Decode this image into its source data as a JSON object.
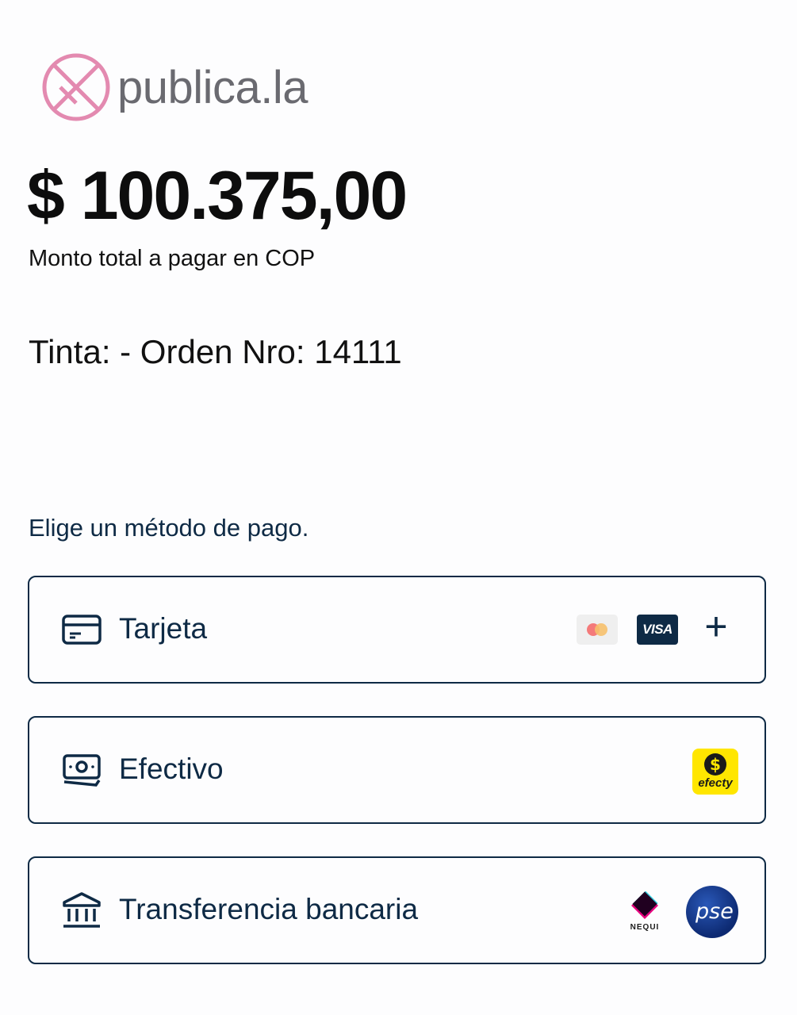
{
  "brand": {
    "name": "publica.la",
    "logo_color": "#e38ab0"
  },
  "payment": {
    "amount": "$ 100.375,00",
    "amount_caption": "Monto total a pagar en COP",
    "order_description": "Tinta: - Orden Nro: 14111"
  },
  "methods_section": {
    "title": "Elige un método de pago.",
    "methods": [
      {
        "label": "Tarjeta",
        "icon": "credit-card-icon",
        "badges": [
          "mastercard-logo",
          "visa-logo",
          "plus-icon"
        ],
        "visa_text": "VISA",
        "plus_text": "+"
      },
      {
        "label": "Efectivo",
        "icon": "cash-icon",
        "badges": [
          "efecty-logo"
        ],
        "efecty_text": "efecty"
      },
      {
        "label": "Transferencia bancaria",
        "icon": "bank-icon",
        "badges": [
          "nequi-logo",
          "pse-logo"
        ],
        "nequi_text": "NEQUI",
        "pse_text": "pse"
      }
    ]
  },
  "colors": {
    "accent": "#0e2a45",
    "efecty_yellow": "#ffe600",
    "pse_blue": "#12378f"
  }
}
